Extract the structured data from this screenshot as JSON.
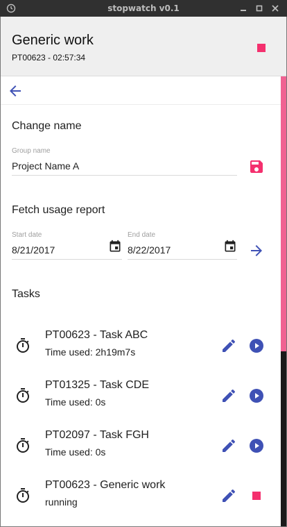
{
  "window": {
    "title": "stopwatch v0.1",
    "controls": [
      "minimize-icon",
      "maximize-icon",
      "close-icon"
    ]
  },
  "header": {
    "title": "Generic work",
    "subtitle": "PT00623 - 02:57:34"
  },
  "change_name": {
    "title": "Change name",
    "group_name_label": "Group name",
    "group_name_value": "Project Name A"
  },
  "usage_report": {
    "title": "Fetch usage report",
    "start_label": "Start date",
    "start_value": "8/21/2017",
    "end_label": "End date",
    "end_value": "8/22/2017"
  },
  "tasks": {
    "title": "Tasks",
    "items": [
      {
        "name": "PT00623 - Task ABC",
        "status": "Time used: 2h19m7s",
        "running": false
      },
      {
        "name": "PT01325 - Task CDE",
        "status": "Time used: 0s",
        "running": false
      },
      {
        "name": "PT02097 - Task FGH",
        "status": "Time used: 0s",
        "running": false
      },
      {
        "name": "PT00623 - Generic work",
        "status": "running",
        "running": true
      }
    ]
  },
  "colors": {
    "accent": "#3f51b5",
    "stop": "#f4306e",
    "header_bg": "#efefef",
    "scroll_thumb": "#f06292"
  }
}
